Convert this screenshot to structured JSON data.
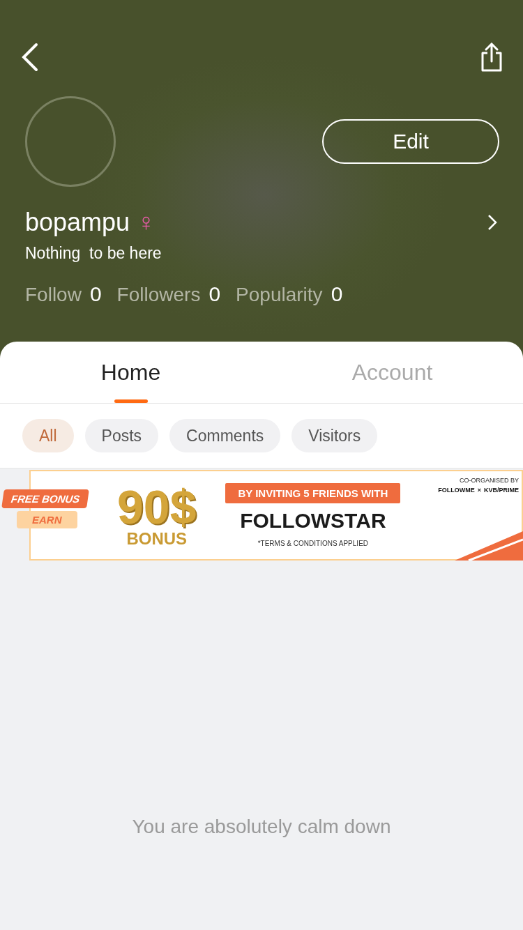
{
  "header": {
    "username": "bopampu",
    "gender_symbol": "♀",
    "bio": "Nothing  to be here",
    "edit_button": "Edit",
    "stats": [
      {
        "label": "Follow",
        "value": "0"
      },
      {
        "label": "Followers",
        "value": "0"
      },
      {
        "label": "Popularity",
        "value": "0"
      }
    ]
  },
  "tabs": [
    {
      "label": "Home",
      "selected": true
    },
    {
      "label": "Account",
      "selected": false
    }
  ],
  "filters": [
    {
      "label": "All",
      "selected": true
    },
    {
      "label": "Posts",
      "selected": false
    },
    {
      "label": "Comments",
      "selected": false
    },
    {
      "label": "Visitors",
      "selected": false
    }
  ],
  "banner": {
    "ribbon_top": "FREE BONUS",
    "ribbon_bottom": "EARN",
    "amount": "90$",
    "amount_caption": "BONUS",
    "headline": "BY INVITING 5 FRIENDS WITH",
    "brand": "FOLLOWSTAR",
    "terms": "*TERMS & CONDITIONS APPLIED",
    "organiser_caption": "CO-ORGANISED BY",
    "organiser_a": "FOLLOWME",
    "organiser_x": "×",
    "organiser_b": "KVB/PRIME"
  },
  "empty_message": "You are absolutely calm down"
}
